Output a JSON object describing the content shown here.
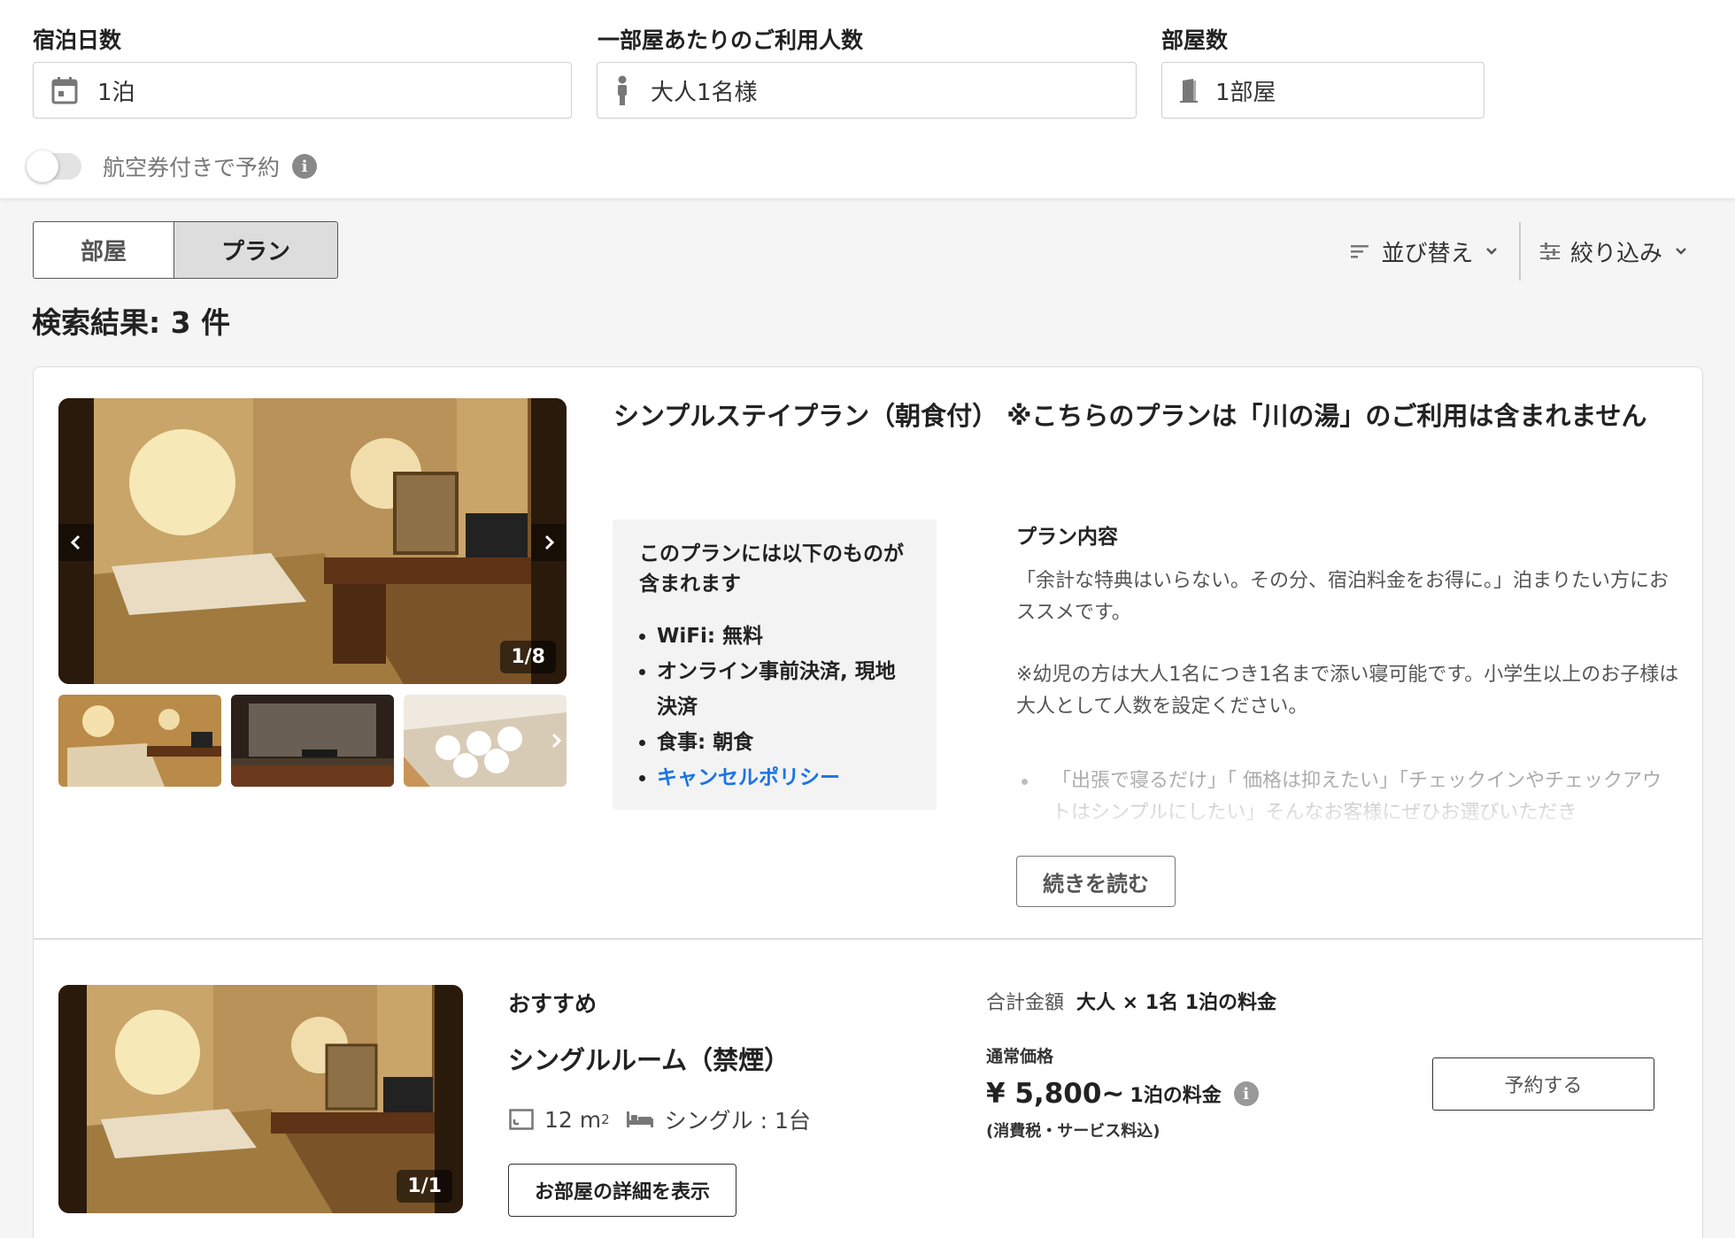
{
  "search": {
    "nights": {
      "label": "宿泊日数",
      "value": "1泊"
    },
    "guests": {
      "label": "一部屋あたりのご利用人数",
      "value": "大人1名様"
    },
    "rooms": {
      "label": "部屋数",
      "value": "1部屋"
    },
    "flight_toggle": {
      "label": "航空券付きで予約",
      "on": false
    }
  },
  "tabs": [
    {
      "label": "部屋",
      "selected": false
    },
    {
      "label": "プラン",
      "selected": true
    }
  ],
  "sort": {
    "sort_label": "並び替え",
    "filter_label": "絞り込み"
  },
  "results": {
    "count_text": "検索結果: 3 件"
  },
  "plan": {
    "title": "シンプルステイプラン（朝食付） ※こちらのプランは「川の湯」のご利用は含まれません",
    "photo_counter": "1/8",
    "includes": {
      "heading": "このプランには以下のものが含まれます",
      "items": [
        "WiFi: 無料",
        "オンライン事前決済, 現地決済",
        "食事: 朝食",
        "キャンセルポリシー"
      ]
    },
    "description": {
      "heading": "プラン内容",
      "paragraphs": [
        "「余計な特典はいらない。その分、宿泊料金をお得に。」泊まりたい方におススメです。",
        "※幼児の方は大人1名につき1名まで添い寝可能です。小学生以上のお子様は大人として人数を設定ください。"
      ],
      "faded": "「出張で寝るだけ」「 価格は抑えたい」「チェックインやチェックアウトはシンプルにしたい」そんなお客様にぜひお選びいただき"
    },
    "read_more": "続きを読む"
  },
  "room": {
    "badge": "おすすめ",
    "name": "シングルルーム（禁煙）",
    "photo_counter": "1/1",
    "area_value": "12 m",
    "area_sup": "2",
    "bed": "シングル : 1台",
    "detail_button": "お部屋の詳細を表示",
    "price": {
      "total_label": "合計金額",
      "basis": "大人 × 1名 1泊の料金",
      "normal_label": "通常価格",
      "value": "¥ 5,800~",
      "unit": "1泊の料金",
      "tax": "(消費税・サービス料込)"
    },
    "reserve_button": "予約する"
  }
}
